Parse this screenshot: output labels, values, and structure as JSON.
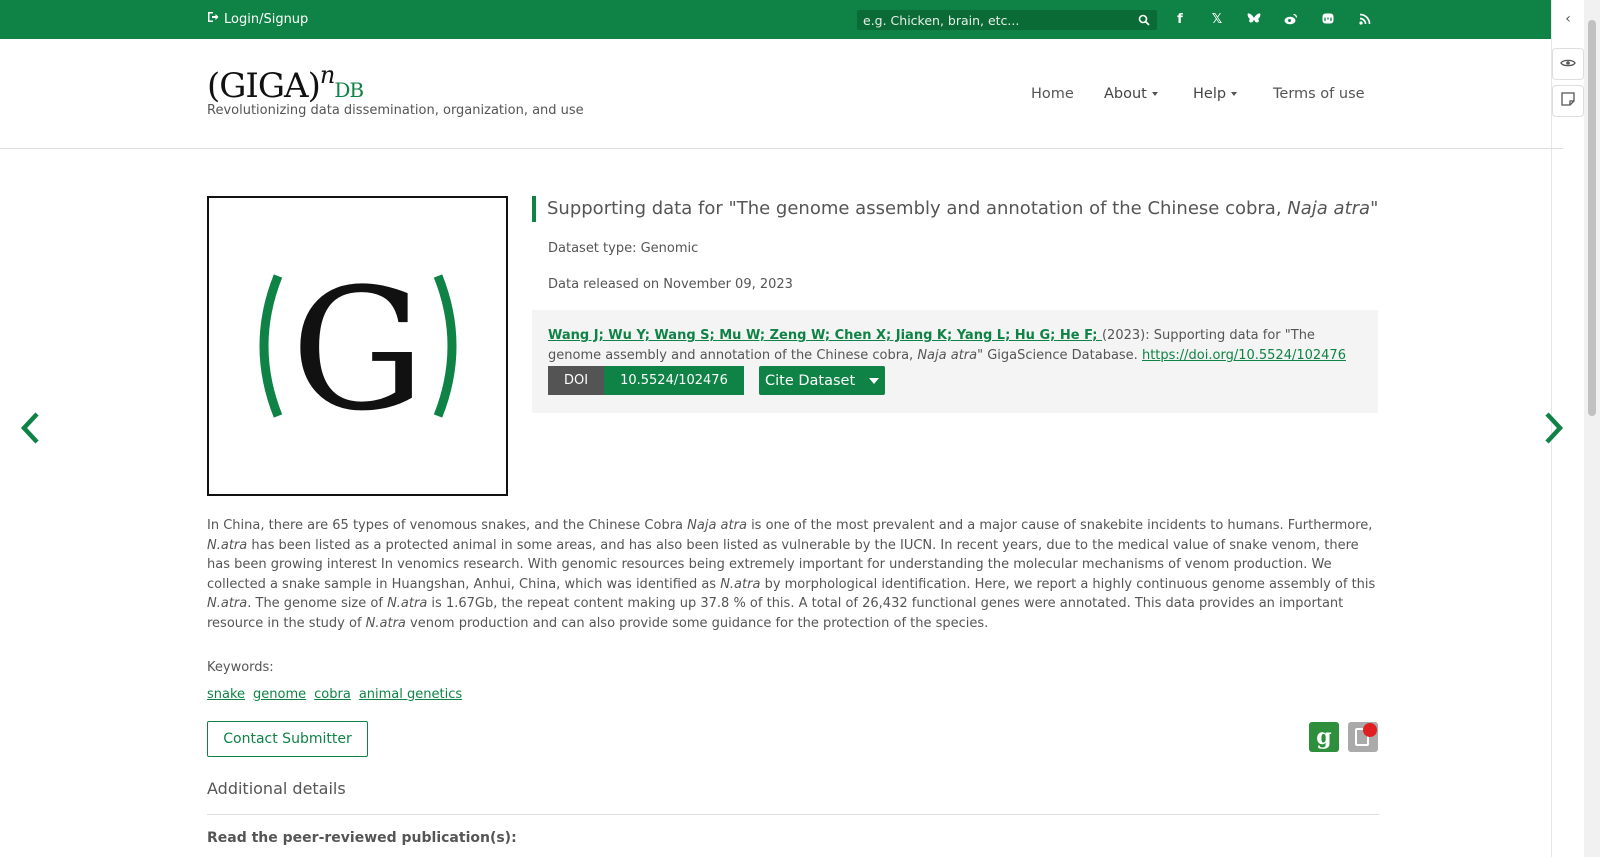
{
  "topbar": {
    "login_label": "Login/Signup",
    "search_placeholder": "e.g. Chicken, brain, etc...",
    "social_icons": [
      "facebook-icon",
      "x-icon",
      "bluesky-icon",
      "weibo-icon",
      "mastodon-icon",
      "rss-icon"
    ]
  },
  "header": {
    "logo_main": "(GIGA)",
    "logo_sup": "n",
    "logo_db": "DB",
    "tagline": "Revolutionizing data dissemination, organization, and use",
    "nav": [
      "Home",
      "About",
      "Help",
      "Terms of use"
    ]
  },
  "dataset": {
    "title_prefix": "Supporting data for \"The genome assembly and annotation of the Chinese cobra, ",
    "title_italic": "Naja atra",
    "title_suffix": "\"",
    "type": "Dataset type: Genomic",
    "released": "Data released on November 09, 2023",
    "authors": "Wang J; Wu Y; Wang S; Mu W; Zeng W; Chen X; Jiang K; Yang L; Hu G; He F; ",
    "citation_year": "(2023): Supporting data for \"The genome assembly and annotation of the Chinese cobra, ",
    "citation_italic": "Naja atra",
    "citation_suffix": "\" GigaScience Database. ",
    "doi_url": "https://doi.org/10.5524/102476",
    "doi_label": "DOI",
    "doi_value": "10.5524/102476",
    "cite_button": "Cite Dataset",
    "image_letter": "G"
  },
  "description": {
    "p1": "In China, there are 65 types of venomous snakes, and the Chinese Cobra ",
    "i1": "Naja atra",
    "p2": " is one of the most prevalent and a major cause of snakebite incidents to humans. Furthermore, ",
    "i2": "N.atra",
    "p3": " has been listed as a protected animal in some areas, and has also been listed as vulnerable by the IUCN. In recent years, due to the medical value of snake venom, there has been growing interest In venomics research. With genomic resources being extremely important for understanding the molecular mechanisms of venom production. We collected a snake sample in Huangshan, Anhui, China, which was identified as ",
    "i3": "N.atra",
    "p4": " by morphological identification. Here, we report a highly continuous genome assembly of this ",
    "i4": "N.atra",
    "p5": ". The genome size of ",
    "i5": "N.atra",
    "p6": " is 1.67Gb, the repeat content making up 37.8 % of this. A total of 26,432 functional genes were annotated. This data provides an important resource in the study of ",
    "i6": "N.atra",
    "p7": " venom production and can also provide some guidance for the protection of the species."
  },
  "keywords": {
    "label": "Keywords:",
    "items": [
      "snake",
      "genome",
      "cobra",
      "animal genetics"
    ]
  },
  "contact_button": "Contact Submitter",
  "additional_details": "Additional details",
  "peer_reviewed": "Read the peer-reviewed publication(s):",
  "colors": {
    "brand": "#0f8345",
    "text": "#555555"
  }
}
